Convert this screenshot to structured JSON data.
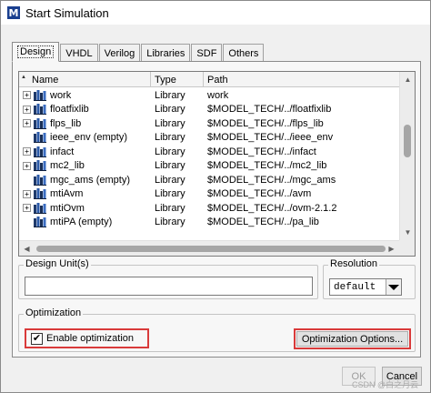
{
  "window": {
    "title": "Start Simulation",
    "logo": "M"
  },
  "tabs": [
    {
      "label": "Design",
      "active": true
    },
    {
      "label": "VHDL"
    },
    {
      "label": "Verilog"
    },
    {
      "label": "Libraries"
    },
    {
      "label": "SDF"
    },
    {
      "label": "Others"
    }
  ],
  "library_list": {
    "columns": [
      "Name",
      "Type",
      "Path"
    ],
    "rows": [
      {
        "name": "work",
        "type": "Library",
        "path": "work",
        "expandable": true
      },
      {
        "name": "floatfixlib",
        "type": "Library",
        "path": "$MODEL_TECH/../floatfixlib",
        "expandable": true
      },
      {
        "name": "flps_lib",
        "type": "Library",
        "path": "$MODEL_TECH/../flps_lib",
        "expandable": true
      },
      {
        "name": "ieee_env  (empty)",
        "type": "Library",
        "path": "$MODEL_TECH/../ieee_env",
        "expandable": false
      },
      {
        "name": "infact",
        "type": "Library",
        "path": "$MODEL_TECH/../infact",
        "expandable": true
      },
      {
        "name": "mc2_lib",
        "type": "Library",
        "path": "$MODEL_TECH/../mc2_lib",
        "expandable": true
      },
      {
        "name": "mgc_ams  (empty)",
        "type": "Library",
        "path": "$MODEL_TECH/../mgc_ams",
        "expandable": false
      },
      {
        "name": "mtiAvm",
        "type": "Library",
        "path": "$MODEL_TECH/../avm",
        "expandable": true
      },
      {
        "name": "mtiOvm",
        "type": "Library",
        "path": "$MODEL_TECH/../ovm-2.1.2",
        "expandable": true
      },
      {
        "name": "mtiPA  (empty)",
        "type": "Library",
        "path": "$MODEL_TECH/../pa_lib",
        "expandable": false
      }
    ]
  },
  "design_unit": {
    "label": "Design Unit(s)",
    "value": ""
  },
  "resolution": {
    "label": "Resolution",
    "value": "default"
  },
  "optimization": {
    "label": "Optimization",
    "enable_label": "Enable optimization",
    "enabled": true,
    "options_label": "Optimization Options..."
  },
  "buttons": {
    "ok": "OK",
    "cancel": "Cancel"
  },
  "watermark": "CSDN @白之月云",
  "colors": {
    "highlight": "#d93a3a",
    "title_icon": "#1a3f8f"
  }
}
